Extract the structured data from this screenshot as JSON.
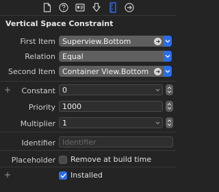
{
  "toolbar": {
    "icons": [
      "file-icon",
      "help-icon",
      "identity-icon",
      "attributes-icon",
      "size-icon",
      "connections-icon"
    ],
    "selected": "size-icon",
    "accent": "#2c6de6"
  },
  "section": {
    "title": "Vertical Space Constraint"
  },
  "first_item": {
    "label": "First Item",
    "value": "Superview.Bottom"
  },
  "relation": {
    "label": "Relation",
    "value": "Equal"
  },
  "second_item": {
    "label": "Second Item",
    "value": "Container View.Bottom"
  },
  "constant": {
    "label": "Constant",
    "value": "0",
    "plus": "+"
  },
  "priority": {
    "label": "Priority",
    "value": "1000"
  },
  "multiplier": {
    "label": "Multiplier",
    "value": "1"
  },
  "identifier": {
    "label": "Identifier",
    "placeholder": "Identifier"
  },
  "placeholder": {
    "label": "Placeholder",
    "checkbox_label": "Remove at build time",
    "checked": false
  },
  "installed": {
    "plus": "+",
    "checkbox_label": "Installed",
    "checked": true
  }
}
